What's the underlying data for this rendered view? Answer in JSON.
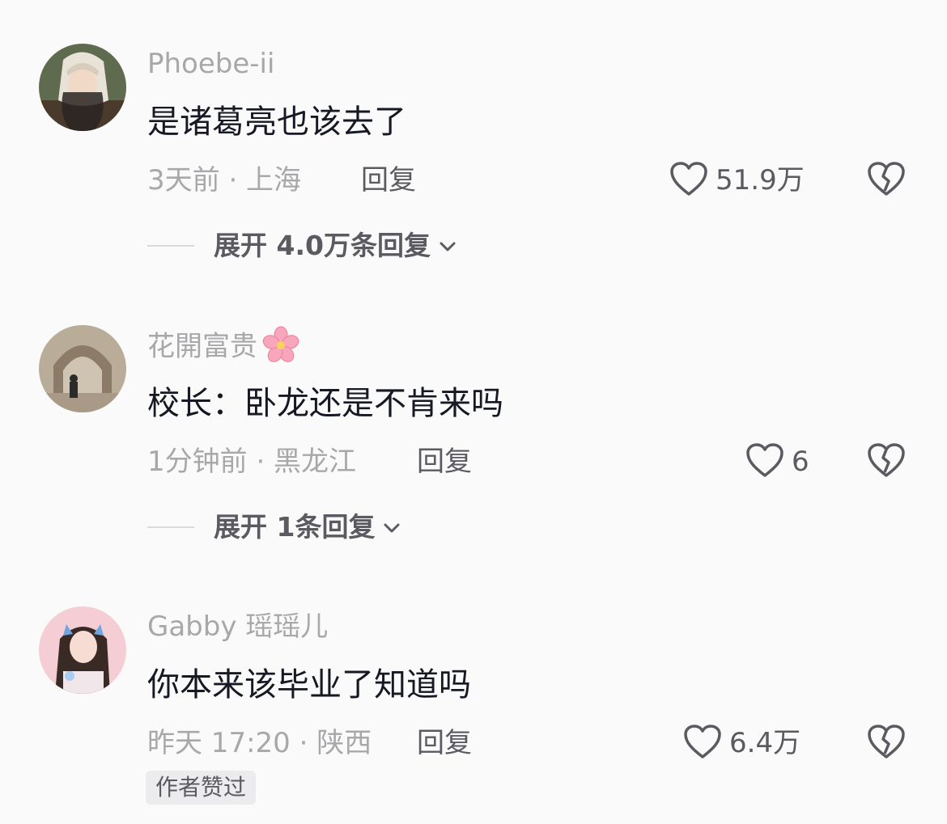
{
  "comments": [
    {
      "username": "Phoebe-ii",
      "text": "是诸葛亮也该去了",
      "meta": "3天前 · 上海",
      "reply_label": "回复",
      "likes": "51.9万",
      "expand_label": "展开 4.0万条回复",
      "colors": {
        "avatar_bg": "#6d7a5e"
      }
    },
    {
      "username": "花開富贵",
      "username_emoji": "cherry-blossom-emoji",
      "text": "校长：卧龙还是不肯来吗",
      "meta": "1分钟前 · 黑龙江",
      "reply_label": "回复",
      "likes": "6",
      "expand_label": "展开 1条回复",
      "colors": {
        "avatar_bg": "#b8ab96"
      }
    },
    {
      "username": "Gabby 瑶瑶儿",
      "text": "你本来该毕业了知道吗",
      "meta": "昨天 17:20 · 陕西",
      "reply_label": "回复",
      "likes": "6.4万",
      "badge": "作者赞过",
      "colors": {
        "avatar_bg": "#f3c6cf"
      }
    }
  ],
  "icons": {
    "like": "heart-outline-icon",
    "dislike": "broken-heart-icon",
    "expand": "chevron-down-icon"
  },
  "colors": {
    "background": "#fafafa",
    "primary_text": "#161823",
    "secondary_text": "#a8a8ab",
    "action_text": "#5a5a60"
  }
}
